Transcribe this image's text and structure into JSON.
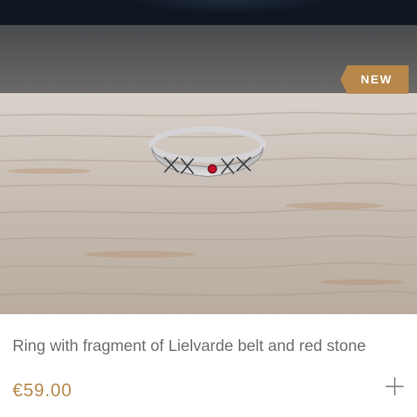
{
  "product": {
    "badge": "NEW",
    "title": "Ring with fragment of Lielvarde belt and red stone",
    "price": "€59.00"
  },
  "icons": {
    "add": "plus-icon"
  },
  "colors": {
    "accent": "#b8884a",
    "title_text": "#6d6d6d",
    "top_bar": "#0f1622"
  }
}
